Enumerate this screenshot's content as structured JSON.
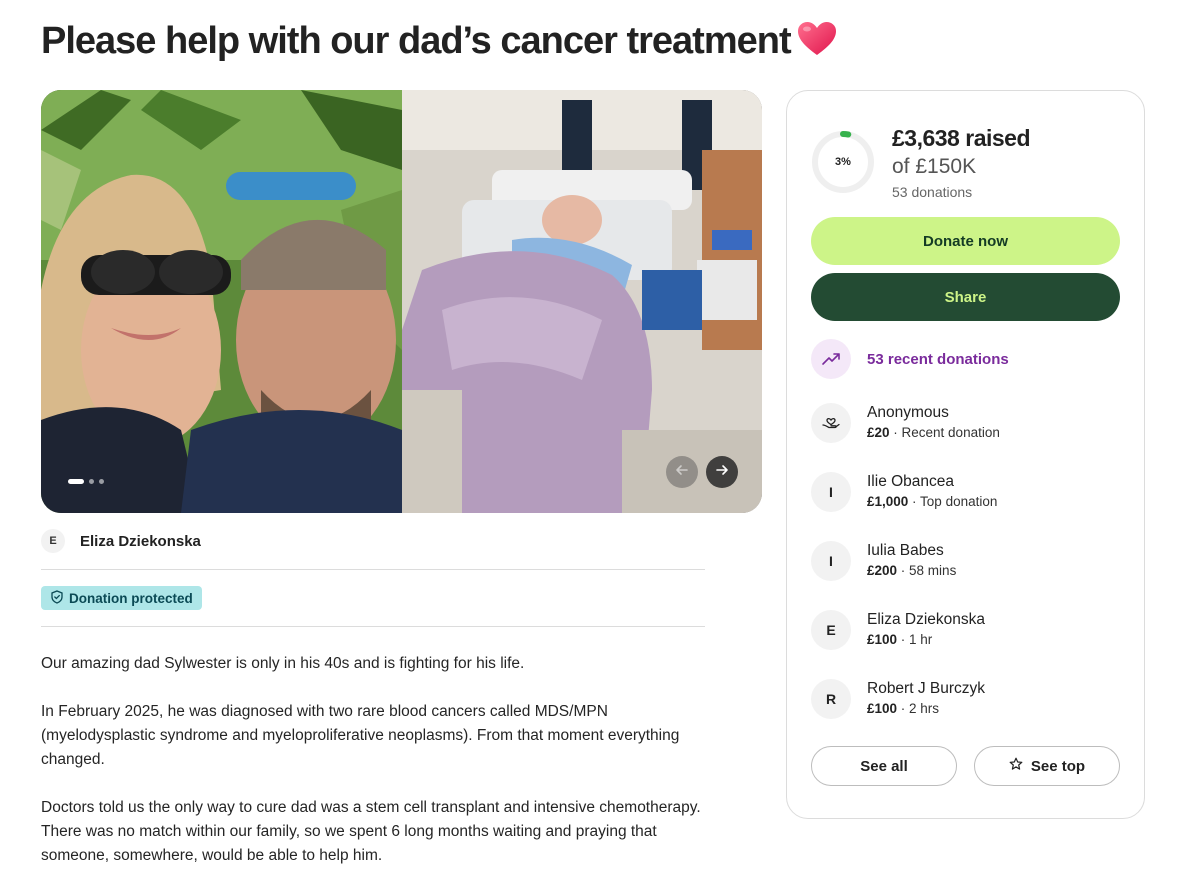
{
  "page": {
    "title": "Please help with our dad’s cancer treatment"
  },
  "gallery": {
    "slide_count": 3,
    "active_slide": 1
  },
  "organizer": {
    "initial": "E",
    "name": "Eliza Dziekonska"
  },
  "badge": {
    "label": "Donation protected"
  },
  "story": {
    "paragraphs": [
      "Our amazing dad Sylwester is only in his 40s and is fighting for his life.",
      "In February 2025, he was diagnosed with two rare blood cancers called MDS/MPN (myelodysplastic syndrome and myeloproliferative neoplasms). From that moment everything changed.",
      "Doctors told us the only way to cure dad was a stem cell transplant and intensive chemotherapy. There was no match within our family, so we spent 6 long months waiting and praying that someone, somewhere, would be able to help him."
    ]
  },
  "fundraiser": {
    "percent_label": "3%",
    "progress_fraction": 0.03,
    "raised": "£3,638 raised",
    "goal": "of £150K",
    "donation_count": "53 donations",
    "donate_label": "Donate now",
    "share_label": "Share",
    "recent_label": "53 recent donations",
    "accent_color": "#cdf488",
    "dark_color": "#234b33",
    "donors": [
      {
        "initial": "",
        "name": "Anonymous",
        "amount": "£20",
        "note": " · Recent donation"
      },
      {
        "initial": "I",
        "name": "Ilie Obancea",
        "amount": "£1,000",
        "note": " · Top donation"
      },
      {
        "initial": "I",
        "name": "Iulia Babes",
        "amount": "£200",
        "note": " · 58 mins"
      },
      {
        "initial": "E",
        "name": "Eliza Dziekonska",
        "amount": "£100",
        "note": " · 1 hr"
      },
      {
        "initial": "R",
        "name": "Robert J Burczyk",
        "amount": "£100",
        "note": " · 2 hrs"
      }
    ],
    "see_all_label": "See all",
    "see_top_label": "See top"
  }
}
